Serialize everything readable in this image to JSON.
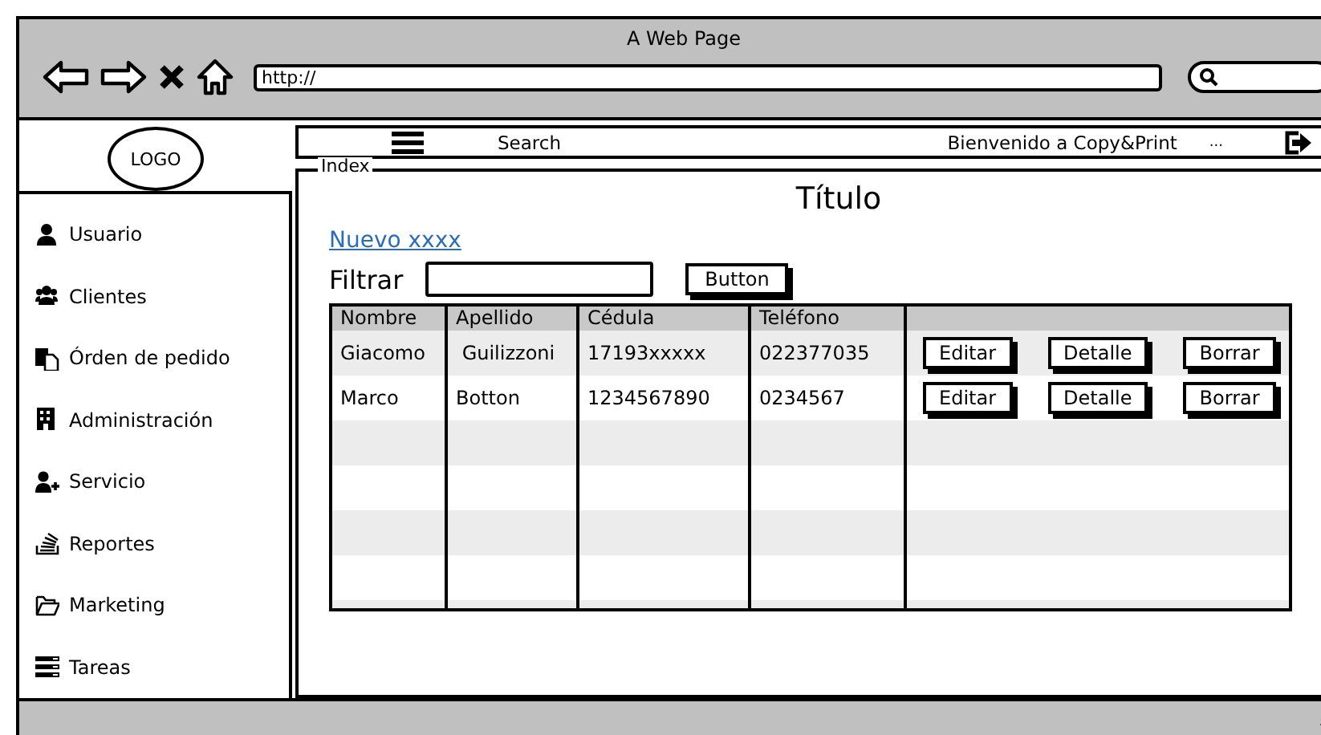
{
  "window": {
    "title": "A Web Page",
    "url": "http://"
  },
  "logo": "LOGO",
  "sidebar": {
    "items": [
      {
        "label": "Usuario"
      },
      {
        "label": "Clientes"
      },
      {
        "label": "Órden de pedido"
      },
      {
        "label": "Administración"
      },
      {
        "label": "Servicio"
      },
      {
        "label": "Reportes"
      },
      {
        "label": "Marketing"
      },
      {
        "label": "Tareas"
      }
    ]
  },
  "navbar": {
    "search": "Search",
    "welcome": "Bienvenido a Copy&Print",
    "more": "..."
  },
  "panel": {
    "legend": "Index",
    "title": "Título",
    "link": "Nuevo xxxx",
    "filter_label": "Filtrar",
    "filter_button": "Button"
  },
  "table": {
    "columns": [
      "Nombre",
      "Apellido",
      "Cédula",
      "Teléfono"
    ],
    "rows": [
      {
        "cells": [
          "Giacomo",
          " Guilizzoni",
          "17193xxxxx",
          "022377035"
        ],
        "actions": [
          "Editar",
          "Detalle",
          "Borrar"
        ]
      },
      {
        "cells": [
          "Marco",
          "Botton",
          "1234567890",
          "0234567"
        ],
        "actions": [
          "Editar",
          "Detalle",
          "Borrar"
        ]
      }
    ]
  }
}
